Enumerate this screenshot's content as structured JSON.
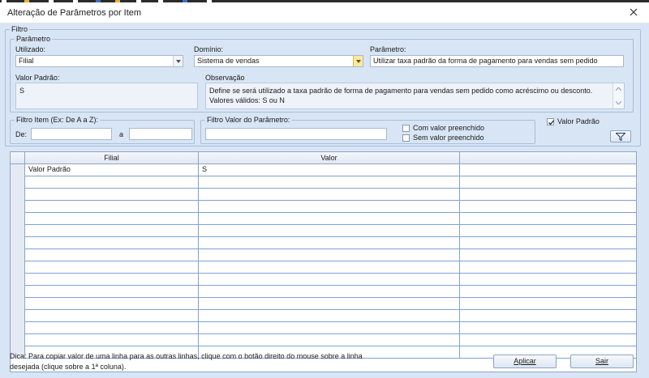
{
  "window": {
    "title": "Alteração de Parâmetros por Item",
    "close_icon": "close-icon"
  },
  "filtro": {
    "group_label": "Filtro",
    "parametro_group_label": "Parâmetro",
    "utilizado_label": "Utilizado:",
    "utilizado_value": "Filial",
    "dominio_label": "Domínio:",
    "dominio_value": "Sistema de vendas",
    "parametro_label": "Parâmetro:",
    "parametro_value": "Utilizar taxa padrão da forma de pagamento para vendas sem pedido",
    "valor_padrao_label": "Valor Padrão:",
    "valor_padrao_value": "S",
    "observacao_label": "Observação",
    "observacao_value": "Define se será utilizado a taxa padrão de forma de pagamento para vendas sem pedido como acréscimo ou desconto. Valores válidos: S ou N"
  },
  "filtro_item": {
    "group_label": "Filtro Item (Ex: De A a Z):",
    "de_label": "De:",
    "de_value": "",
    "a_label": "a",
    "a_value": ""
  },
  "filtro_valor": {
    "group_label": "Filtro Valor do Parâmetro:",
    "value": "",
    "com_valor_label": "Com valor preenchido",
    "com_valor_checked": false,
    "sem_valor_label": "Sem valor preenchido",
    "sem_valor_checked": false
  },
  "valor_padrao_check": {
    "label": "Valor Padrão",
    "checked": true
  },
  "filter_button_icon": "funnel-icon",
  "grid": {
    "columns": [
      "Filial",
      "Valor",
      ""
    ],
    "rows": [
      [
        "Valor Padrão",
        "S",
        ""
      ],
      [
        "",
        "",
        ""
      ],
      [
        "",
        "",
        ""
      ],
      [
        "",
        "",
        ""
      ],
      [
        "",
        "",
        ""
      ],
      [
        "",
        "",
        ""
      ],
      [
        "",
        "",
        ""
      ],
      [
        "",
        "",
        ""
      ],
      [
        "",
        "",
        ""
      ],
      [
        "",
        "",
        ""
      ],
      [
        "",
        "",
        ""
      ],
      [
        "",
        "",
        ""
      ],
      [
        "",
        "",
        ""
      ],
      [
        "",
        "",
        ""
      ],
      [
        "",
        "",
        ""
      ],
      [
        "",
        "",
        ""
      ]
    ]
  },
  "footer": {
    "hint": "Dica: Para copiar valor de uma linha para as outras linhas, clique com o botão direito do mouse sobre a linha desejada (clique sobre a 1ª coluna).",
    "aplicar_label": "Aplicar",
    "sair_label": "Sair"
  },
  "colors": {
    "background": "#d8e5f5",
    "grid_line": "#7fa2d2",
    "combo_accent": "#fbe8a0"
  }
}
